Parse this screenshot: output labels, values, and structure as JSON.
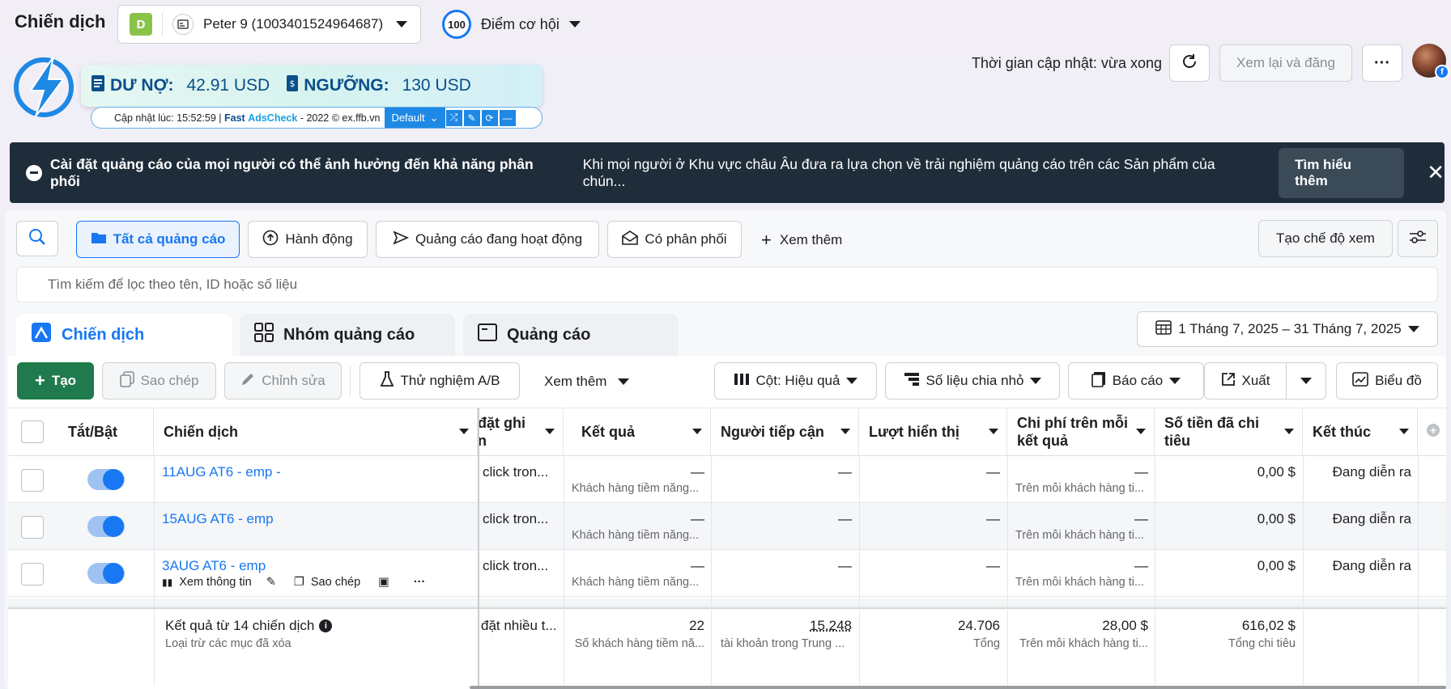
{
  "header": {
    "title": "Chiến dịch",
    "account": {
      "badge": "D",
      "name": "Peter 9 (1003401524964687)"
    },
    "opportunity": {
      "score": "100",
      "label": "Điểm cơ hội"
    },
    "update_time": "Thời gian cập nhật: vừa xong",
    "review_publish": "Xem lại và đăng",
    "more": "···"
  },
  "extension": {
    "debt_label": "DƯ NỢ:",
    "debt_value": "42.91 USD",
    "threshold_label": "NGƯỠNG:",
    "threshold_value": "130 USD",
    "updated": "Cập nhật lúc: 15:52:59 |",
    "brand_a": "Fast",
    "brand_b": "AdsCheck",
    "brand_rest": "- 2022 © ex.ffb.vn",
    "profile": "Default"
  },
  "banner": {
    "title": "Cài đặt quảng cáo của mọi người có thể ảnh hưởng đến khả năng phân phối",
    "body": "Khi mọi người ở Khu vực châu Âu đưa ra lựa chọn về trải nghiệm quảng cáo trên các Sản phẩm của chún...",
    "learn_more": "Tìm hiểu thêm"
  },
  "filters": {
    "all_ads": "Tất cả quảng cáo",
    "actions": "Hành động",
    "active_ads": "Quảng cáo đang hoạt động",
    "delivering": "Có phân phối",
    "see_more": "Xem thêm",
    "create_view": "Tạo chế độ xem",
    "search_placeholder": "Tìm kiếm để lọc theo tên, ID hoặc số liệu"
  },
  "tabs": {
    "campaigns": "Chiến dịch",
    "adsets": "Nhóm quảng cáo",
    "ads": "Quảng cáo",
    "date_range": "1 Tháng 7, 2025 – 31 Tháng 7, 2025"
  },
  "toolbar": {
    "create": "Tạo",
    "duplicate": "Sao chép",
    "edit": "Chỉnh sửa",
    "ab_test": "Thử nghiệm A/B",
    "see_more": "Xem thêm",
    "columns": "Cột: Hiệu quả",
    "breakdown": "Số liệu chia nhỏ",
    "reports": "Báo cáo",
    "export": "Xuất",
    "chart": "Biểu đồ"
  },
  "table": {
    "headers": {
      "toggle": "Tắt/Bật",
      "campaign": "Chiến dịch",
      "attribution_1": "đặt ghi",
      "attribution_2": "n",
      "results": "Kết quả",
      "reach": "Người tiếp cận",
      "impressions": "Lượt hiển thị",
      "cpr_1": "Chi phí trên mỗi",
      "cpr_2": "kết quả",
      "spent_1": "Số tiền đã chi",
      "spent_2": "tiêu",
      "ends": "Kết thúc"
    },
    "rows": [
      {
        "name": "11AUG AT6 - emp -",
        "attr": "click tron...",
        "result": "—",
        "result_sub": "Khách hàng tiềm năng...",
        "reach": "—",
        "impr": "—",
        "cpr": "—",
        "cpr_sub": "Trên mỗi khách hàng ti...",
        "spent": "0,00 $",
        "ends": "Đang diễn ra"
      },
      {
        "name": "15AUG AT6 - emp",
        "attr": "click tron...",
        "result": "—",
        "result_sub": "Khách hàng tiềm năng...",
        "reach": "—",
        "impr": "—",
        "cpr": "—",
        "cpr_sub": "Trên mỗi khách hàng ti...",
        "spent": "0,00 $",
        "ends": "Đang diễn ra"
      },
      {
        "name": "3AUG AT6 - emp",
        "attr": "click tron...",
        "result": "—",
        "result_sub": "Khách hàng tiềm năng...",
        "reach": "—",
        "impr": "—",
        "cpr": "—",
        "cpr_sub": "Trên mỗi khách hàng ti...",
        "spent": "0,00 $",
        "ends": "Đang diễn ra"
      }
    ],
    "row_actions": {
      "view": "Xem thông tin",
      "duplicate": "Sao chép"
    },
    "footer": {
      "title": "Kết quả từ 14 chiến dịch",
      "subtitle": "Loại trừ các mục đã xóa",
      "attr": "đặt nhiều t...",
      "results": "22",
      "results_sub": "Số khách hàng tiềm nă...",
      "reach": "15.248",
      "reach_sub": "tài khoản trong Trung ...",
      "impr": "24.706",
      "impr_sub": "Tổng",
      "cpr": "28,00 $",
      "cpr_sub": "Trên mỗi khách hàng ti...",
      "spent": "616,02 $",
      "spent_sub": "Tổng chi tiêu"
    }
  }
}
